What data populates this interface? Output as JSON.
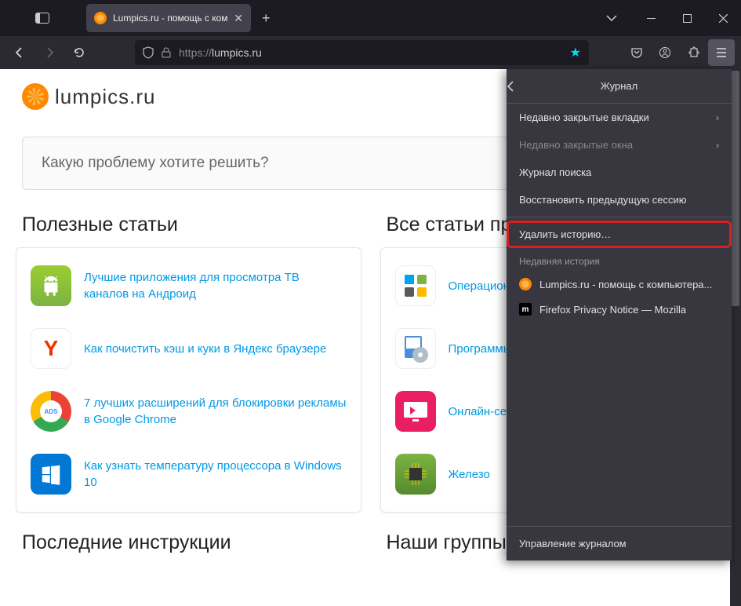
{
  "tab": {
    "title": "Lumpics.ru - помощь с компь"
  },
  "url": {
    "protocol": "https://",
    "host": "lumpics.ru"
  },
  "logo": "lumpics.ru",
  "search": {
    "placeholder": "Какую проблему хотите решить?"
  },
  "left_col": {
    "heading": "Полезные статьи",
    "items": [
      "Лучшие приложения для просмотра ТВ каналов на Андроид",
      "Как почистить кэш и куки в Яндекс браузере",
      "7 лучших расширений для блокировки рекламы в Google Chrome",
      "Как узнать температуру процессора в Windows 10"
    ]
  },
  "right_col": {
    "heading": "Все статьи про:",
    "items": [
      "Операционн",
      "Программы",
      "Онлайн-се",
      "Железо"
    ]
  },
  "bottom": {
    "left": "Последние инструкции",
    "right": "Наши группы в"
  },
  "panel": {
    "title": "Журнал",
    "recent_tabs": "Недавно закрытые вкладки",
    "recent_windows": "Недавно закрытые окна",
    "search_history": "Журнал поиска",
    "restore": "Восстановить предыдущую сессию",
    "clear": "Удалить историю…",
    "recent_history": "Недавняя история",
    "hist1": "Lumpics.ru - помощь с компьютера...",
    "hist2": "Firefox Privacy Notice — Mozilla",
    "manage": "Управление журналом"
  }
}
